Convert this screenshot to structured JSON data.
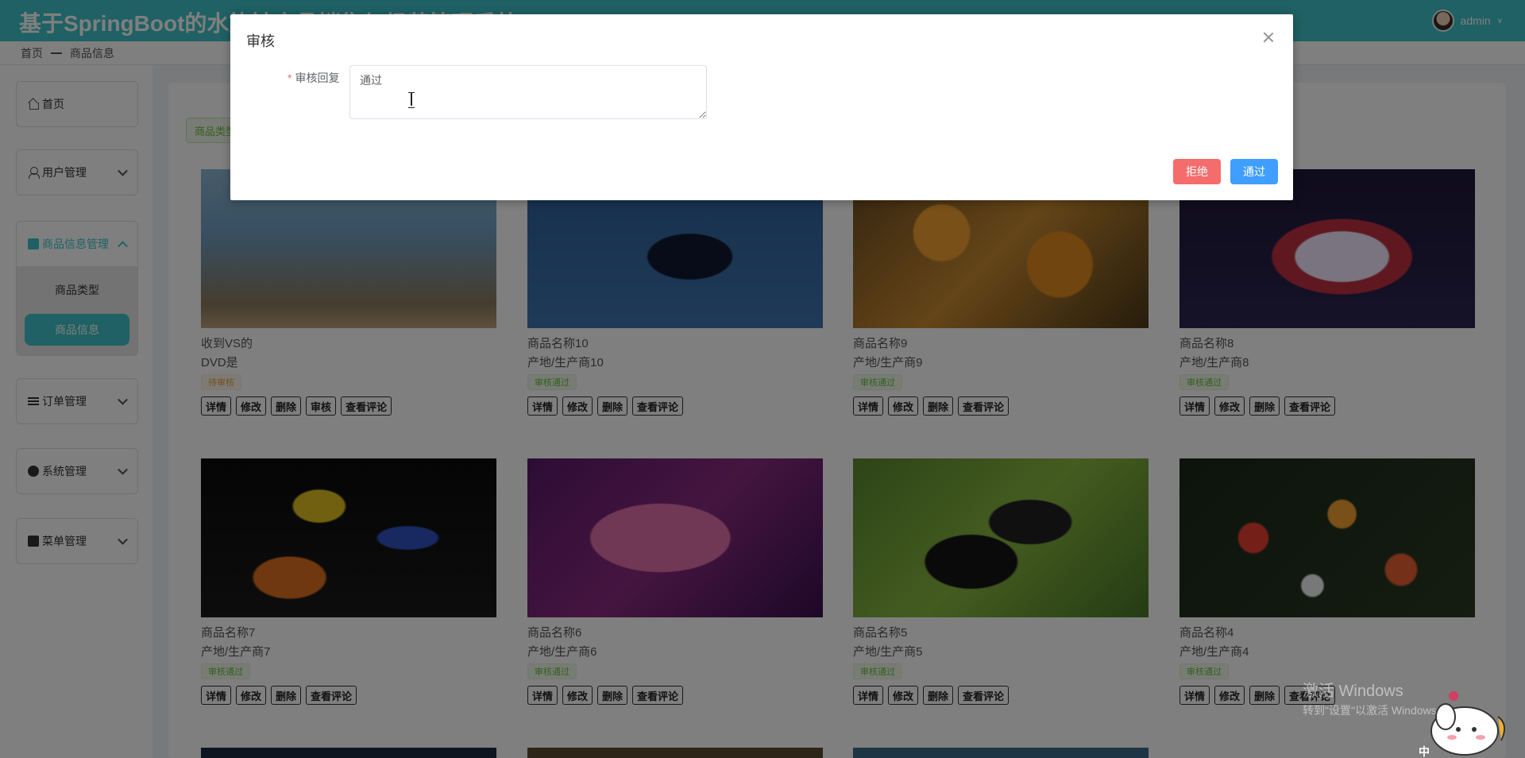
{
  "header": {
    "title": "基于SpringBoot的水族馆商品销售与经营管理系统",
    "user": "admin"
  },
  "breadcrumb": {
    "home": "首页",
    "current": "商品信息"
  },
  "sidebar": {
    "home": "首页",
    "user_mgmt": "用户管理",
    "goods_mgmt": "商品信息管理",
    "goods_sub": [
      "商品类型",
      "商品信息"
    ],
    "order_mgmt": "订单管理",
    "system_mgmt": "系统管理",
    "menu_mgmt": "菜单管理"
  },
  "main": {
    "category_button": "商品类型"
  },
  "products": [
    {
      "name": "收到VS的",
      "origin": "DVD是",
      "status": "待审核",
      "status_type": "pending",
      "actions": [
        "详情",
        "修改",
        "删除",
        "审核",
        "查看评论"
      ]
    },
    {
      "name": "商品名称10",
      "origin": "产地/生产商10",
      "status": "审核通过",
      "status_type": "pass",
      "actions": [
        "详情",
        "修改",
        "删除",
        "查看评论"
      ]
    },
    {
      "name": "商品名称9",
      "origin": "产地/生产商9",
      "status": "审核通过",
      "status_type": "pass",
      "actions": [
        "详情",
        "修改",
        "删除",
        "查看评论"
      ]
    },
    {
      "name": "商品名称8",
      "origin": "产地/生产商8",
      "status": "审核通过",
      "status_type": "pass",
      "actions": [
        "详情",
        "修改",
        "删除",
        "查看评论"
      ]
    },
    {
      "name": "商品名称7",
      "origin": "产地/生产商7",
      "status": "审核通过",
      "status_type": "pass",
      "actions": [
        "详情",
        "修改",
        "删除",
        "查看评论"
      ]
    },
    {
      "name": "商品名称6",
      "origin": "产地/生产商6",
      "status": "审核通过",
      "status_type": "pass",
      "actions": [
        "详情",
        "修改",
        "删除",
        "查看评论"
      ]
    },
    {
      "name": "商品名称5",
      "origin": "产地/生产商5",
      "status": "审核通过",
      "status_type": "pass",
      "actions": [
        "详情",
        "修改",
        "删除",
        "查看评论"
      ]
    },
    {
      "name": "商品名称4",
      "origin": "产地/生产商4",
      "status": "审核通过",
      "status_type": "pass",
      "actions": [
        "详情",
        "修改",
        "删除",
        "查看评论"
      ]
    }
  ],
  "dialog": {
    "title": "审核",
    "field_label": "审核回复",
    "reply_value": "通过",
    "reject_label": "拒绝",
    "pass_label": "通过"
  },
  "watermark": {
    "line1": "激活 Windows",
    "line2": "转到\"设置\"以激活 Windows。"
  },
  "ime_indicator": "中",
  "colors": {
    "primary": "#3fc3c9",
    "reject": "#f56c6c",
    "pass": "#409eff"
  }
}
